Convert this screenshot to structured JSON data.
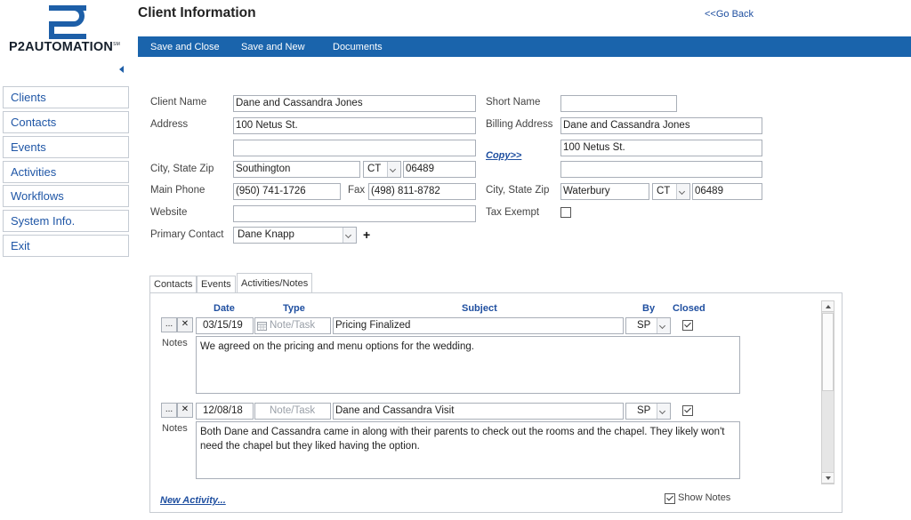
{
  "brand": {
    "name": "P2AUTOMATION",
    "sm": "SM",
    "logo_color": "#1d5fa8"
  },
  "header": {
    "title": "Client Information",
    "back_label": "<<Go Back"
  },
  "toolbar": {
    "save_close": "Save and Close",
    "save_new": "Save and New",
    "documents": "Documents",
    "color": "#1a64ac"
  },
  "sidebar": {
    "items": [
      "Clients",
      "Contacts",
      "Events",
      "Activities",
      "Workflows",
      "System Info.",
      "Exit"
    ]
  },
  "form": {
    "client_name": {
      "label": "Client Name",
      "value": "Dane and Cassandra Jones"
    },
    "address": {
      "label": "Address",
      "line1": "100 Netus St.",
      "line2": ""
    },
    "city_state_zip": {
      "label": "City, State Zip",
      "city": "Southington",
      "state": "CT",
      "zip": "06489"
    },
    "main_phone": {
      "label": "Main Phone",
      "value": "(950) 741-1726"
    },
    "fax": {
      "label": "Fax",
      "value": "(498) 811-8782"
    },
    "website": {
      "label": "Website",
      "value": ""
    },
    "primary_contact": {
      "label": "Primary Contact",
      "value": "Dane Knapp",
      "add": "+"
    },
    "short_name": {
      "label": "Short Name",
      "value": ""
    },
    "billing_address": {
      "label": "Billing Address",
      "line1": "Dane and Cassandra Jones",
      "line2": "100 Netus St.",
      "line3": ""
    },
    "copy_label": "Copy>>",
    "billing_city_state_zip": {
      "label": "City, State Zip",
      "city": "Waterbury",
      "state": "CT",
      "zip": "06489"
    },
    "tax_exempt": {
      "label": "Tax Exempt",
      "checked": false
    }
  },
  "tabs": [
    "Contacts",
    "Events",
    "Activities/Notes"
  ],
  "activities": {
    "columns": {
      "date": "Date",
      "type": "Type",
      "subject": "Subject",
      "by": "By",
      "closed": "Closed"
    },
    "rows": [
      {
        "more": "...",
        "delete": "✕",
        "date": "03/15/19",
        "type_placeholder": "Note/Task",
        "subject": "Pricing Finalized",
        "by": "SP",
        "closed": true,
        "notes_label": "Notes",
        "notes": "We agreed on the pricing and menu options for the wedding."
      },
      {
        "more": "...",
        "delete": "✕",
        "date": "12/08/18",
        "type_placeholder": "Note/Task",
        "subject": "Dane and Cassandra Visit",
        "by": "SP",
        "closed": true,
        "notes_label": "Notes",
        "notes": "Both Dane and Cassandra came in along with their parents to check out the rooms and the chapel.  They likely won't need the chapel but they liked having the option."
      }
    ],
    "new_activity": "New Activity...",
    "show_notes": {
      "label": "Show Notes",
      "checked": true
    }
  }
}
